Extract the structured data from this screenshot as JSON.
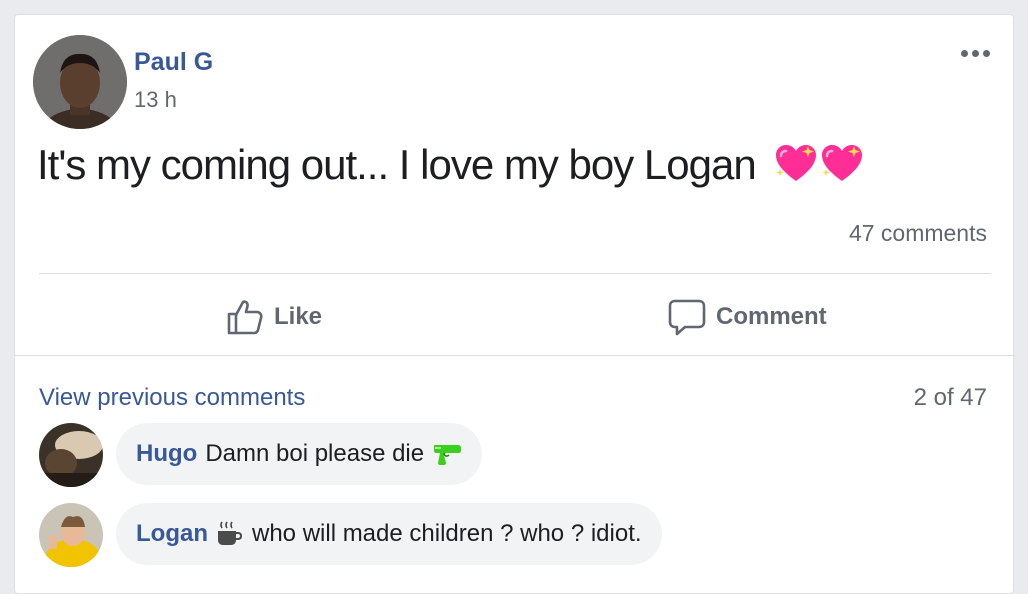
{
  "post": {
    "author": "Paul G",
    "time": "13 h",
    "text": "It's my coming out... I love my boy Logan",
    "text_emoji": [
      "sparkling-heart",
      "sparkling-heart"
    ],
    "comment_count": "47 comments"
  },
  "actions": {
    "like_label": "Like",
    "comment_label": "Comment"
  },
  "comments_section": {
    "view_previous": "View previous comments",
    "pagination": "2 of 47",
    "comments": [
      {
        "author": "Hugo",
        "text": "Damn boi please die",
        "emoji": "water-pistol"
      },
      {
        "author": "Logan",
        "text": "who will made children ? who ? idiot.",
        "emoji": "hot-beverage"
      }
    ]
  },
  "colors": {
    "link_blue": "#385898",
    "muted_text": "#616770",
    "bubble_bg": "#f2f3f5",
    "heart_pink": "#ff2d96"
  }
}
